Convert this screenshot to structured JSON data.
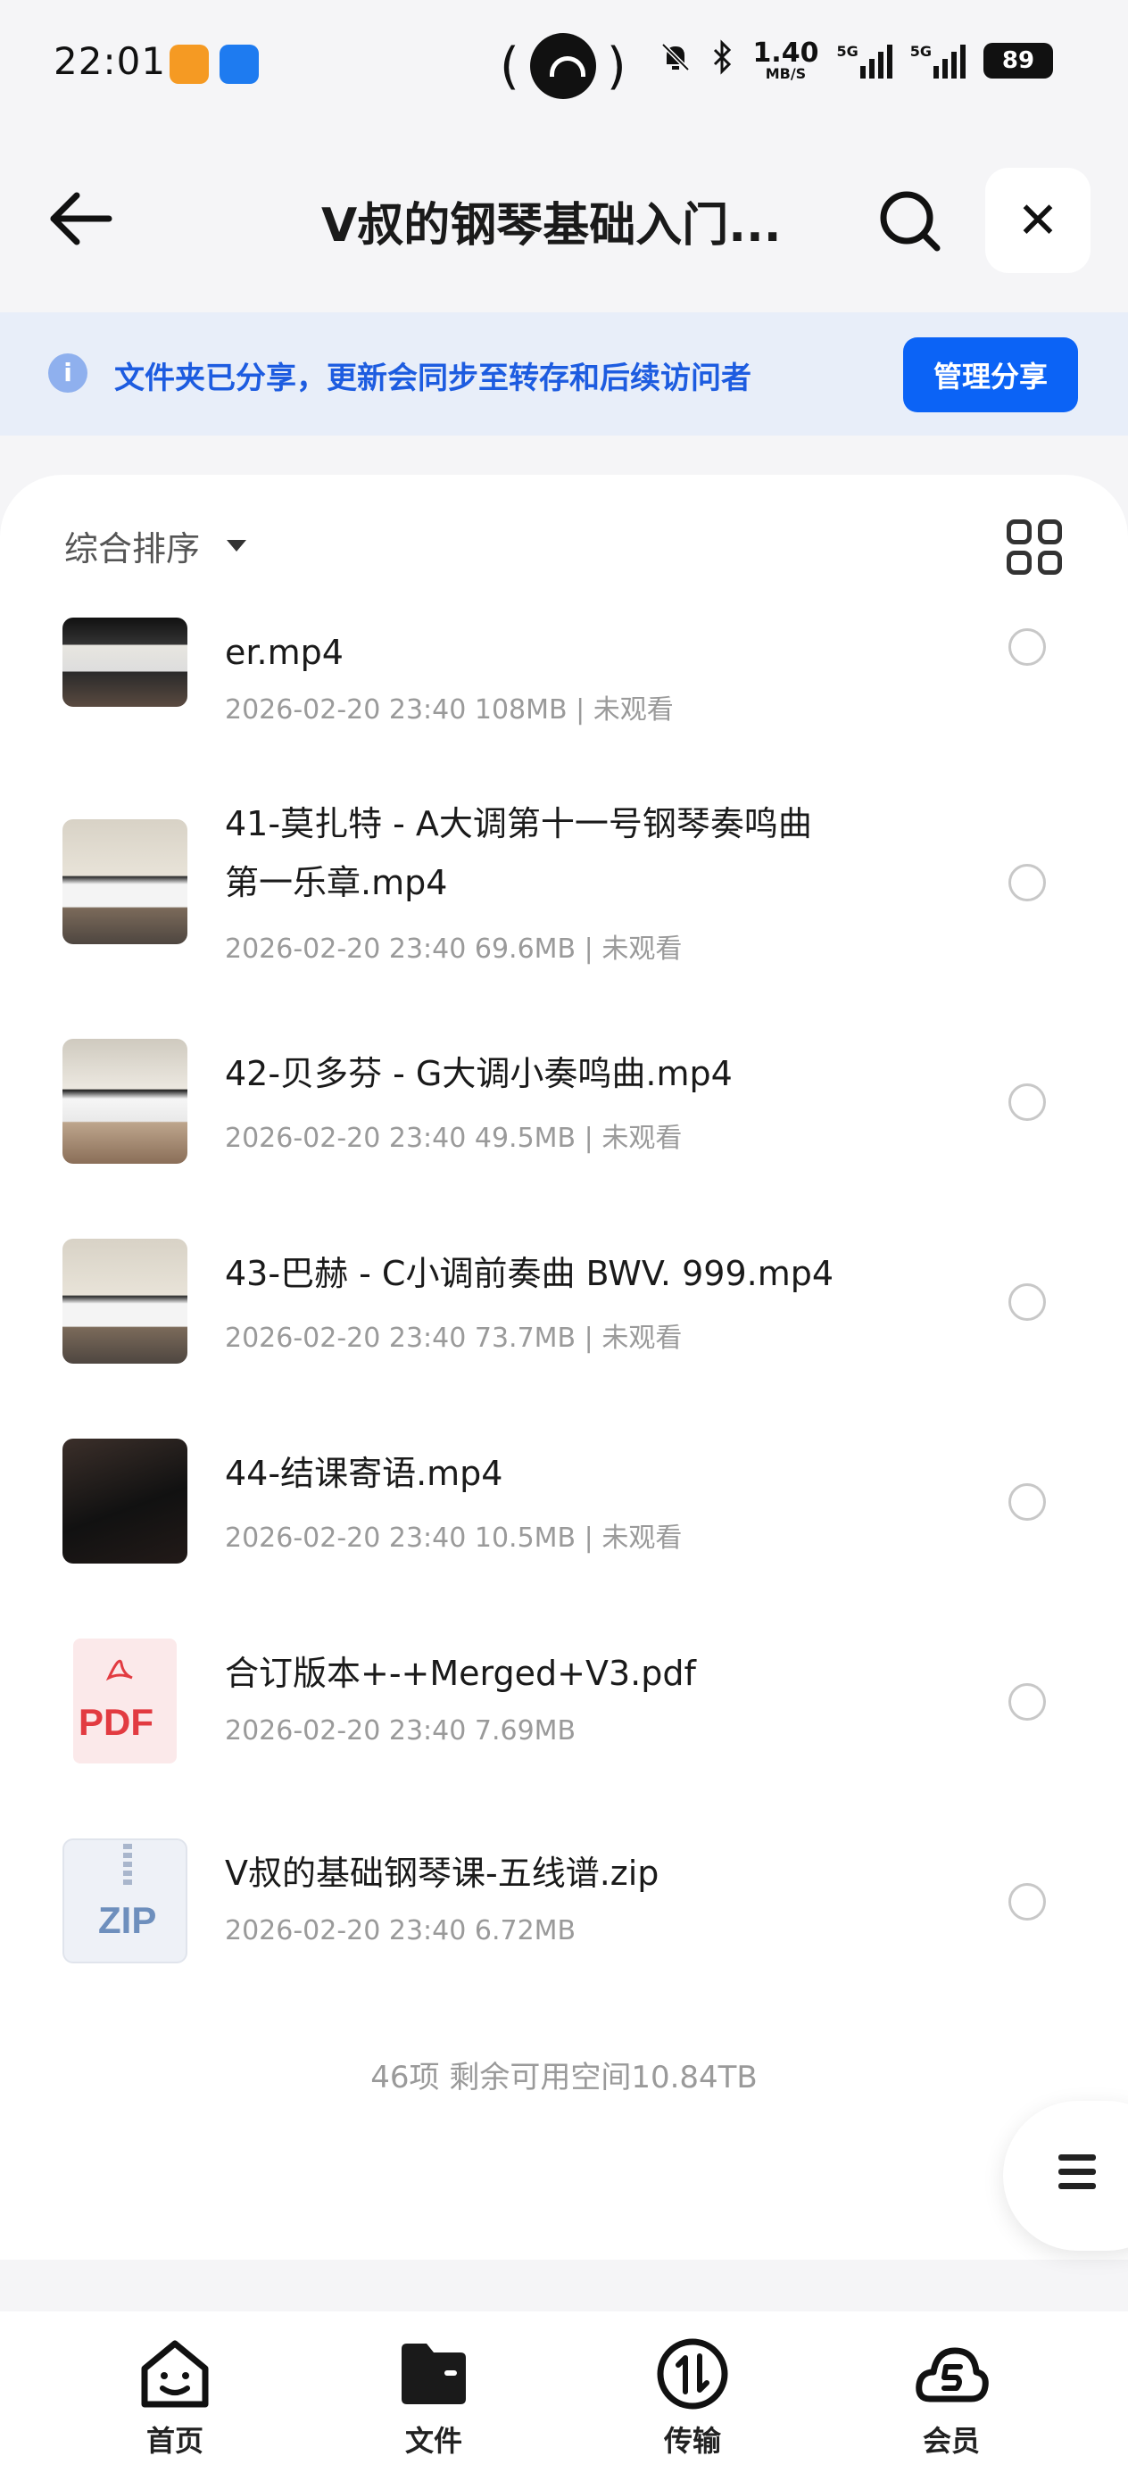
{
  "status_bar": {
    "time": "22:01",
    "net_speed": "1.40",
    "net_unit": "MB/S",
    "sim1": "5G",
    "sim2": "5G",
    "battery": "89"
  },
  "header": {
    "title": "V叔的钢琴基础入门..."
  },
  "share_banner": {
    "text": "文件夹已分享，更新会同步至转存和后续访问者",
    "button": "管理分享"
  },
  "toolbar": {
    "sort_label": "综合排序"
  },
  "files": [
    {
      "name": "er.mp4",
      "meta": "2026-02-20 23:40  108MB | 未观看",
      "thumb": "video"
    },
    {
      "name": "41-莫扎特 - A大调第十一号钢琴奏鸣曲",
      "name2": "第一乐章.mp4",
      "meta": "2026-02-20 23:40  69.6MB | 未观看",
      "thumb": "video"
    },
    {
      "name": "42-贝多芬 - G大调小奏鸣曲.mp4",
      "meta": "2026-02-20 23:40  49.5MB | 未观看",
      "thumb": "video"
    },
    {
      "name": "43-巴赫 - C小调前奏曲 BWV. 999.mp4",
      "meta": "2026-02-20 23:40  73.7MB | 未观看",
      "thumb": "video"
    },
    {
      "name": "44-结课寄语.mp4",
      "meta": "2026-02-20 23:40  10.5MB | 未观看",
      "thumb": "video"
    },
    {
      "name": "合订版本+-+Merged+V3.pdf",
      "meta": "2026-02-20 23:40  7.69MB",
      "thumb": "pdf",
      "thumb_label": "PDF"
    },
    {
      "name": "V叔的基础钢琴课-五线谱.zip",
      "meta": "2026-02-20 23:40  6.72MB",
      "thumb": "zip",
      "thumb_label": "ZIP"
    }
  ],
  "footer_note": "46项 剩余可用空间10.84TB",
  "bottom_nav": [
    {
      "label": "首页",
      "icon": "home-smile-icon"
    },
    {
      "label": "文件",
      "icon": "folder-icon"
    },
    {
      "label": "传输",
      "icon": "transfer-icon"
    },
    {
      "label": "会员",
      "icon": "member-cloud-icon"
    }
  ],
  "colors": {
    "accent": "#0b63f6",
    "banner_bg": "#e8eef9",
    "banner_text": "#1d5ce0",
    "meta_text": "#9a9a9a"
  }
}
